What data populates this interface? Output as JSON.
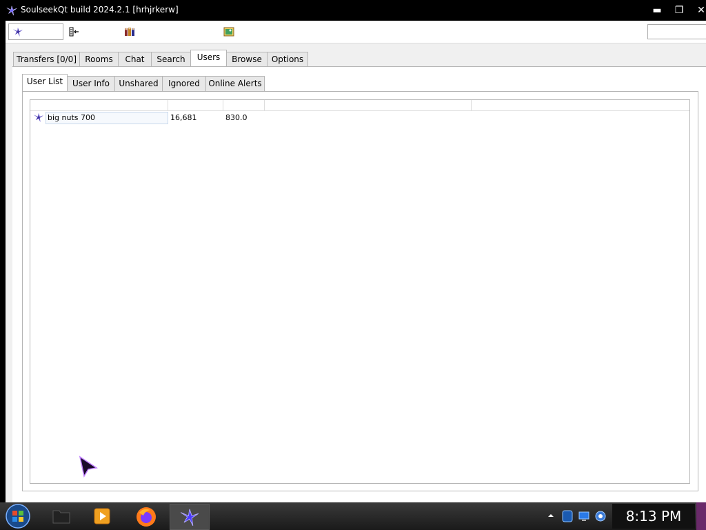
{
  "window": {
    "title": "SoulseekQt build 2024.2.1 [hrhjrkerw]"
  },
  "title_buttons": {
    "minimize": "▬",
    "maximize": "❐",
    "close": "✕"
  },
  "main_tabs": [
    {
      "label": "Transfers [0/0]",
      "active": false
    },
    {
      "label": "Rooms",
      "active": false
    },
    {
      "label": "Chat",
      "active": false
    },
    {
      "label": "Search",
      "active": false
    },
    {
      "label": "Users",
      "active": true
    },
    {
      "label": "Browse",
      "active": false
    },
    {
      "label": "Options",
      "active": false
    }
  ],
  "sub_tabs": [
    {
      "label": "User List",
      "active": true
    },
    {
      "label": "User Info",
      "active": false
    },
    {
      "label": "Unshared",
      "active": false
    },
    {
      "label": "Ignored",
      "active": false
    },
    {
      "label": "Online Alerts",
      "active": false
    }
  ],
  "user_list": {
    "rows": [
      {
        "name": "big nuts 700",
        "files": "16,681",
        "speed": "830.0"
      }
    ]
  },
  "taskbar": {
    "clock": "8:13 PM"
  },
  "colors": {
    "accent_purple": "#3b2d9e",
    "titlebar": "#000000",
    "clock_bg": "#111111"
  }
}
